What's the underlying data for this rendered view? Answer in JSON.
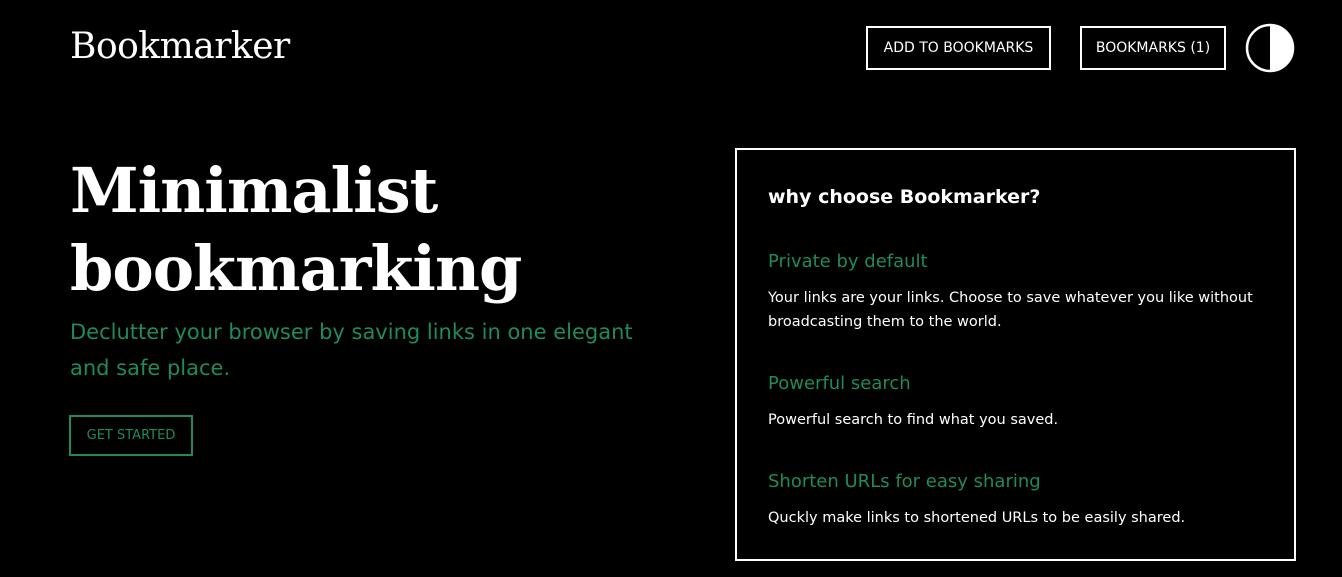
{
  "header": {
    "logo": "Bookmarker",
    "add_to_bookmarks_label": "ADD TO BOOKMARKS",
    "bookmarks_label": "BOOKMARKS (1)",
    "theme_toggle_icon": "half-circle-icon"
  },
  "hero": {
    "title_line1": "Minimalist",
    "title_line2": "bookmarking",
    "subtitle": "Declutter your browser by saving links in one elegant and safe place.",
    "cta_label": "GET STARTED"
  },
  "features": {
    "title": "why choose Bookmarker?",
    "items": [
      {
        "heading": "Private by default",
        "text": "Your links are your links. Choose to save whatever you like without broadcasting them to the world."
      },
      {
        "heading": "Powerful search",
        "text": "Powerful search to find what you saved."
      },
      {
        "heading": "Shorten URLs for easy sharing",
        "text": "Quckly make links to shortened URLs to be easily shared."
      }
    ]
  },
  "colors": {
    "background": "#000000",
    "foreground": "#ffffff",
    "accent": "#1f8a5b"
  }
}
